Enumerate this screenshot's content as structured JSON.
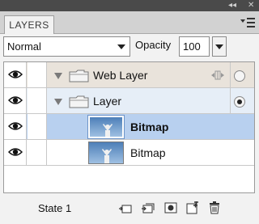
{
  "window": {
    "collapse_glyph": "◂◂",
    "close_glyph": "✕"
  },
  "panel": {
    "tab_label": "LAYERS",
    "menu_icon": "panel-menu-icon"
  },
  "controls": {
    "blend_mode": "Normal",
    "opacity_label": "Opacity",
    "opacity_value": "100"
  },
  "layers": [
    {
      "name": "Web Layer",
      "type": "folder",
      "visible": true,
      "expanded": true,
      "bold": false,
      "selected": false,
      "active_radio": false
    },
    {
      "name": "Layer",
      "type": "folder",
      "visible": true,
      "expanded": true,
      "bold": false,
      "selected": false,
      "active_radio": true
    },
    {
      "name": "Bitmap",
      "type": "bitmap",
      "visible": true,
      "bold": true,
      "selected": true
    },
    {
      "name": "Bitmap",
      "type": "bitmap",
      "visible": true,
      "bold": false,
      "selected": false
    }
  ],
  "status": {
    "state_label": "State 1",
    "icons": [
      "new-sublayer-icon",
      "duplicate-layer-icon",
      "add-mask-icon",
      "new-layer-icon",
      "trash-icon"
    ]
  },
  "colors": {
    "row_folder_top": "#e9e3db",
    "row_folder_active": "#e6eef7",
    "row_selected": "#b8d0ef",
    "title_bar": "#4a4a4a"
  }
}
